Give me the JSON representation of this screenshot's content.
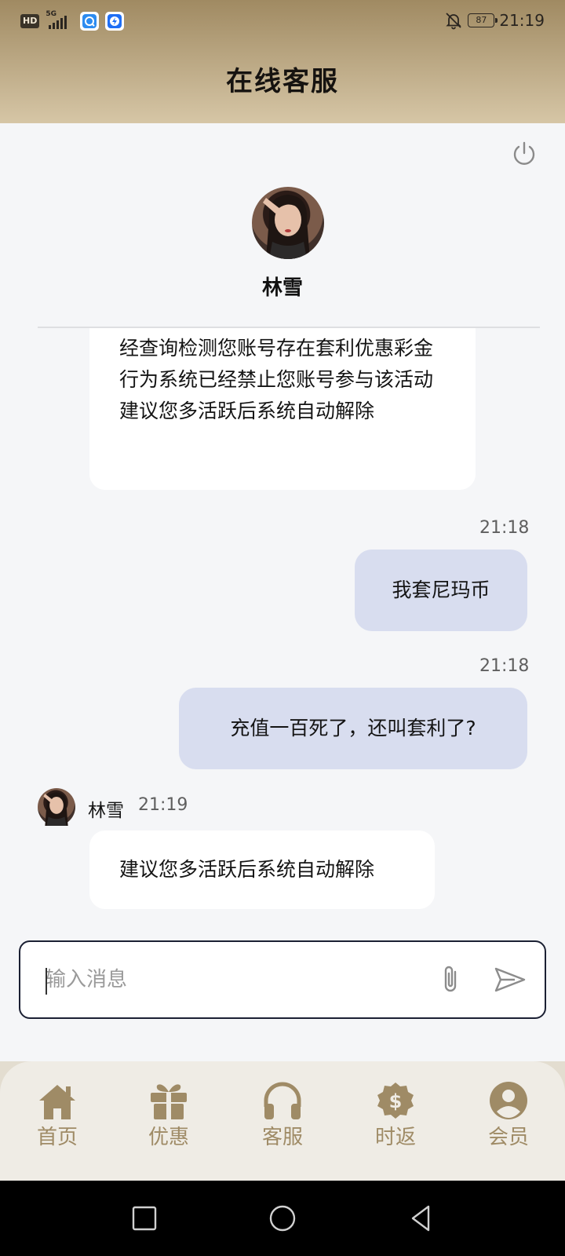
{
  "status_bar": {
    "hd": "HD",
    "network": "5G",
    "battery": "87",
    "time": "21:19"
  },
  "header": {
    "title": "在线客服"
  },
  "agent": {
    "name": "林雪"
  },
  "messages": [
    {
      "direction": "in",
      "text": "经查询检测您账号存在套利优惠彩金行为系统已经禁止您账号参与该活动建议您多活跃后系统自动解除"
    },
    {
      "direction": "out",
      "time": "21:18",
      "text": "我套尼玛币"
    },
    {
      "direction": "out",
      "time": "21:18",
      "text": "充值一百死了，还叫套利了?"
    },
    {
      "direction": "in",
      "sender": "林雪",
      "time": "21:19",
      "text": "建议您多活跃后系统自动解除"
    }
  ],
  "input": {
    "placeholder": "输入消息",
    "value": ""
  },
  "bottom_nav": {
    "items": [
      {
        "label": "首页",
        "icon": "home-icon"
      },
      {
        "label": "优惠",
        "icon": "gift-icon"
      },
      {
        "label": "客服",
        "icon": "headset-icon"
      },
      {
        "label": "时返",
        "icon": "cashback-icon"
      },
      {
        "label": "会员",
        "icon": "member-icon"
      }
    ],
    "active_color": "#9f8b66"
  },
  "colors": {
    "header_gradient_top": "#a08a62",
    "header_gradient_bottom": "#d6c6a6",
    "outgoing_bubble": "#d8ddef",
    "incoming_bubble": "#ffffff",
    "background": "#f5f6f8"
  }
}
